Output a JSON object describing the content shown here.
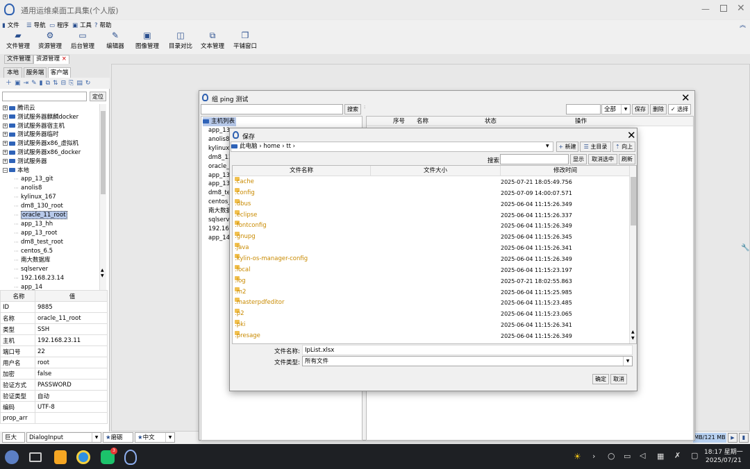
{
  "app": {
    "title": "通用运维桌面工具集(个人版)"
  },
  "menu": [
    {
      "label": "文件",
      "icon": "file-icon"
    },
    {
      "label": "导航",
      "icon": "list-icon"
    },
    {
      "label": "程序",
      "icon": "program-icon"
    },
    {
      "label": "工具",
      "icon": "briefcase-icon"
    },
    {
      "label": "帮助",
      "icon": "help-icon"
    }
  ],
  "toolbar": [
    "文件管理",
    "资源管理",
    "后台管理",
    "编辑器",
    "图像管理",
    "目录对比",
    "文本管理",
    "平铺窗口"
  ],
  "doc_tabs": [
    {
      "label": "文件管理"
    },
    {
      "label": "资源管理",
      "close": "×"
    }
  ],
  "side_tabs": [
    "本地",
    "服务端",
    "客户端"
  ],
  "locate_label": "定位",
  "tree": {
    "groups": [
      "腾讯云",
      "测试服务器麒麟docker",
      "测试服务器宿主机",
      "测试服务器临时",
      "测试服务器x86_虚拟机",
      "测试服务器x86_docker",
      "测试服务器",
      "本地"
    ],
    "items": [
      "app_13_git",
      "anolis8",
      "kylinux_167",
      "dm8_130_root",
      "oracle_11_root",
      "app_13_hh",
      "app_13_root",
      "dm8_test_root",
      "centos_6.5",
      "南大数据库",
      "sqlserver",
      "192.168.23.14",
      "app_14"
    ],
    "selected": "oracle_11_root"
  },
  "props": {
    "headers": [
      "名称",
      "值"
    ],
    "rows": [
      [
        "ID",
        "9885"
      ],
      [
        "名称",
        "oracle_11_root"
      ],
      [
        "类型",
        "SSH"
      ],
      [
        "主机",
        "192.168.23.11"
      ],
      [
        "端口号",
        "22"
      ],
      [
        "用户名",
        "root"
      ],
      [
        "加密",
        "false"
      ],
      [
        "验证方式",
        "PASSWORD"
      ],
      [
        "验证类型",
        "自动"
      ],
      [
        "编码",
        "UTF-8"
      ],
      [
        "prop_arr",
        ""
      ]
    ]
  },
  "statusbar": {
    "size": "巨大",
    "font": "DialogInput",
    "theme": "磨砺",
    "lang": "中文",
    "memory": "MB/121 MB"
  },
  "ping_dialog": {
    "title": "组 ping 测试",
    "search_btn": "搜索",
    "root": "主机列表",
    "items": [
      "app_13_",
      "anolis8",
      "kylinux_",
      "dm8_13",
      "oracle_",
      "app_13_",
      "app_13_",
      "dm8_te",
      "centos_",
      "南大数据",
      "sqlserve",
      "192.168.",
      "app_14"
    ],
    "filter": "全部",
    "save": "保存",
    "delete": "删除",
    "select": "选择",
    "cols": [
      "序号",
      "名称",
      "状态",
      "操作"
    ]
  },
  "save_dialog": {
    "title": "保存",
    "path": [
      "此电脑",
      "home",
      "tt"
    ],
    "new_btn": "新建",
    "home_btn": "主目录",
    "up_btn": "向上",
    "search_label": "搜索",
    "show_btn": "显示",
    "deselect_btn": "取消选中",
    "refresh_btn": "刷新",
    "cols": [
      "文件名称",
      "文件大小",
      "修改时间"
    ],
    "files": [
      {
        "name": ".cache",
        "time": "2025-07-21 18:05:49.756"
      },
      {
        "name": ".config",
        "time": "2025-07-09 14:00:07.571"
      },
      {
        "name": ".dbus",
        "time": "2025-06-04 11:15:26.349"
      },
      {
        "name": ".eclipse",
        "time": "2025-06-04 11:15:26.337"
      },
      {
        "name": ".fontconfig",
        "time": "2025-06-04 11:15:26.349"
      },
      {
        "name": ".gnupg",
        "time": "2025-06-04 11:15:26.345"
      },
      {
        "name": ".java",
        "time": "2025-06-04 11:15:26.341"
      },
      {
        "name": ".kylin-os-manager-config",
        "time": "2025-06-04 11:15:26.349"
      },
      {
        "name": ".local",
        "time": "2025-06-04 11:15:23.197"
      },
      {
        "name": ".log",
        "time": "2025-07-21 18:02:55.863"
      },
      {
        "name": ".m2",
        "time": "2025-06-04 11:15:25.985"
      },
      {
        "name": ".masterpdfeditor",
        "time": "2025-06-04 11:15:23.485"
      },
      {
        "name": ".p2",
        "time": "2025-06-04 11:15:23.065"
      },
      {
        "name": ".pki",
        "time": "2025-06-04 11:15:26.341"
      },
      {
        "name": ".presage",
        "time": "2025-06-04 11:15:26.349"
      }
    ],
    "filename_label": "文件名称:",
    "filename": "IpList.xlsx",
    "filetype_label": "文件类型:",
    "filetype": "所有文件",
    "ok_btn": "确定",
    "cancel_btn": "取消"
  },
  "taskbar": {
    "badge": "3",
    "time": "18:17 星期一",
    "date": "2025/07/21"
  }
}
